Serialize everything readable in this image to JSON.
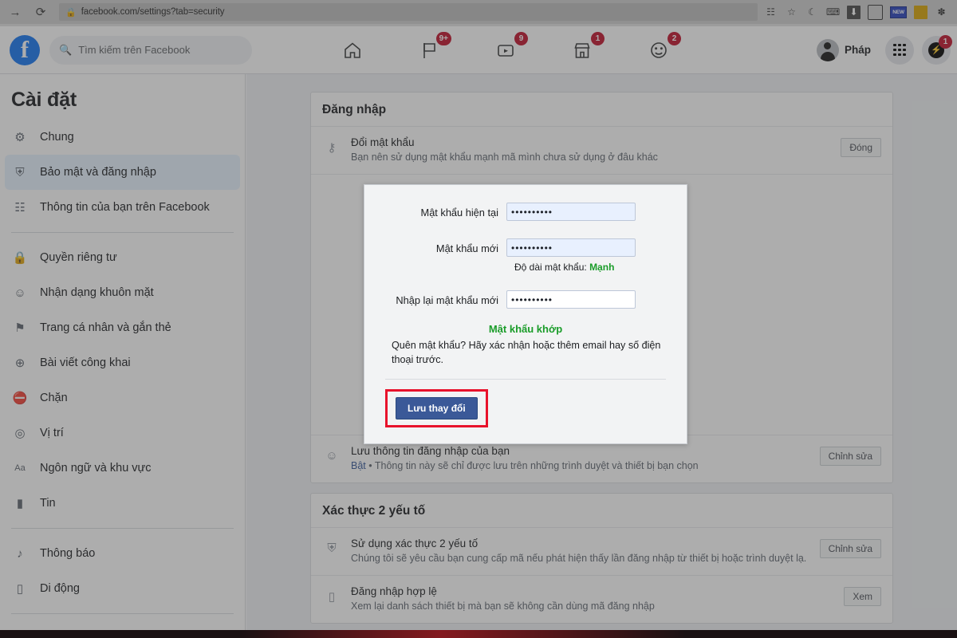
{
  "browser": {
    "back_icon": "arrow-right-icon",
    "reload_icon": "reload-icon",
    "lock_icon": "lock-icon",
    "url": "facebook.com/settings?tab=security",
    "extensions": [
      {
        "name": "key-icon",
        "glyph": "⚷"
      },
      {
        "name": "bookmark-star-icon",
        "glyph": "☆"
      },
      {
        "name": "dark-mode-moon-icon",
        "glyph": "☾"
      },
      {
        "name": "shield-adblock-icon",
        "glyph": "⛨"
      },
      {
        "name": "download-icon",
        "glyph": "⬇"
      },
      {
        "name": "picture-in-picture-icon",
        "glyph": "■"
      },
      {
        "name": "new-badge-icon",
        "glyph": "NEW"
      },
      {
        "name": "yellow-lock-icon",
        "glyph": "▬"
      },
      {
        "name": "puzzle-extension-icon",
        "glyph": "✽"
      }
    ]
  },
  "fb_header": {
    "logo_letter": "f",
    "search_placeholder": "Tìm kiếm trên Facebook",
    "search_icon": "search-icon",
    "nav": [
      {
        "name": "nav-home",
        "icon": "home-icon",
        "glyph": "⌂",
        "badge": ""
      },
      {
        "name": "nav-pages",
        "icon": "flag-icon",
        "glyph": "⚑",
        "badge": "9+"
      },
      {
        "name": "nav-watch",
        "icon": "video-icon",
        "glyph": "▶",
        "badge": "9"
      },
      {
        "name": "nav-marketplace",
        "icon": "store-icon",
        "glyph": "⌂",
        "badge": "1"
      },
      {
        "name": "nav-groups",
        "icon": "groups-icon",
        "glyph": "☺",
        "badge": "2"
      }
    ],
    "profile_name": "Pháp",
    "menu_icon": "grid-menu-icon",
    "messenger_icon": "messenger-icon",
    "messenger_badge": "1"
  },
  "sidebar": {
    "title": "Cài đặt",
    "items": [
      {
        "label": "Chung",
        "icon": "gear-icon",
        "glyph": "⚙",
        "active": false,
        "sep_after": false
      },
      {
        "label": "Bảo mật và đăng nhập",
        "icon": "shield-icon",
        "glyph": "⛨",
        "active": true,
        "sep_after": false
      },
      {
        "label": "Thông tin của bạn trên Facebook",
        "icon": "grid-info-icon",
        "glyph": "☷",
        "active": false,
        "sep_after": true
      },
      {
        "label": "Quyền riêng tư",
        "icon": "lock-icon",
        "glyph": "🔒",
        "active": false,
        "sep_after": false
      },
      {
        "label": "Nhận dạng khuôn mặt",
        "icon": "face-recognition-icon",
        "glyph": "☺",
        "active": false,
        "sep_after": false
      },
      {
        "label": "Trang cá nhân và gắn thẻ",
        "icon": "tag-icon",
        "glyph": "⚑",
        "active": false,
        "sep_after": false
      },
      {
        "label": "Bài viết công khai",
        "icon": "globe-icon",
        "glyph": "⊕",
        "active": false,
        "sep_after": false
      },
      {
        "label": "Chặn",
        "icon": "block-user-icon",
        "glyph": "⛔",
        "active": false,
        "sep_after": false
      },
      {
        "label": "Vị trí",
        "icon": "location-pin-icon",
        "glyph": "◎",
        "active": false,
        "sep_after": false
      },
      {
        "label": "Ngôn ngữ và khu vực",
        "icon": "language-icon",
        "glyph": "Aa",
        "active": false,
        "sep_after": false
      },
      {
        "label": "Tin",
        "icon": "stories-icon",
        "glyph": "▮",
        "active": false,
        "sep_after": true
      },
      {
        "label": "Thông báo",
        "icon": "bell-icon",
        "glyph": "♪",
        "active": false,
        "sep_after": false
      },
      {
        "label": "Di động",
        "icon": "mobile-icon",
        "glyph": "▯",
        "active": false,
        "sep_after": true
      }
    ]
  },
  "main": {
    "sections": [
      {
        "title": "Đăng nhập",
        "rows": [
          {
            "icon": "key-icon",
            "glyph": "⚷",
            "title": "Đổi mật khẩu",
            "sub": "Bạn nên sử dụng mật khẩu mạnh mã mình chưa sử dụng ở đâu khác",
            "sub_prefix": "",
            "button": "Đóng"
          },
          {
            "icon": "person-circle-icon",
            "glyph": "☺",
            "title": "Lưu thông tin đăng nhập của bạn",
            "sub": " • Thông tin này sẽ chỉ được lưu trên những trình duyệt và thiết bị bạn chọn",
            "sub_prefix": "Bật",
            "button": "Chỉnh sửa"
          }
        ]
      },
      {
        "title": "Xác thực 2 yếu tố",
        "rows": [
          {
            "icon": "shield-check-icon",
            "glyph": "⛨",
            "title": "Sử dụng xác thực 2 yếu tố",
            "sub": "Chúng tôi sẽ yêu cầu bạn cung cấp mã nếu phát hiện thấy lần đăng nhập từ thiết bị hoặc trình duyệt lạ.",
            "sub_prefix": "",
            "button": "Chỉnh sửa"
          },
          {
            "icon": "mobile-icon",
            "glyph": "▯",
            "title": "Đăng nhập hợp lệ",
            "sub": "Xem lại danh sách thiết bị mà bạn sẽ không cần dùng mã đăng nhập",
            "sub_prefix": "",
            "button": "Xem"
          }
        ]
      }
    ]
  },
  "modal": {
    "fields": [
      {
        "label": "Mật khẩu hiện tại",
        "value": "••••••••••",
        "autofill": true
      },
      {
        "label": "Mật khẩu mới",
        "value": "••••••••••",
        "autofill": true
      },
      {
        "label": "Nhập lại mật khẩu mới",
        "value": "••••••••••",
        "autofill": false
      }
    ],
    "strength_label": "Độ dài mật khẩu:",
    "strength_value": "Mạnh",
    "match_text": "Mật khẩu khớp",
    "forgot_text": "Quên mật khẩu? Hãy xác nhận hoặc thêm email hay số điện thoại trước.",
    "save_label": "Lưu thay đổi",
    "annotation_color": "#e8122b"
  },
  "colors": {
    "fb_blue": "#1877f2",
    "button_blue": "#3b5998",
    "green": "#1a9c29",
    "badge_red": "#c2142d",
    "annotation_red": "#e8122b"
  }
}
